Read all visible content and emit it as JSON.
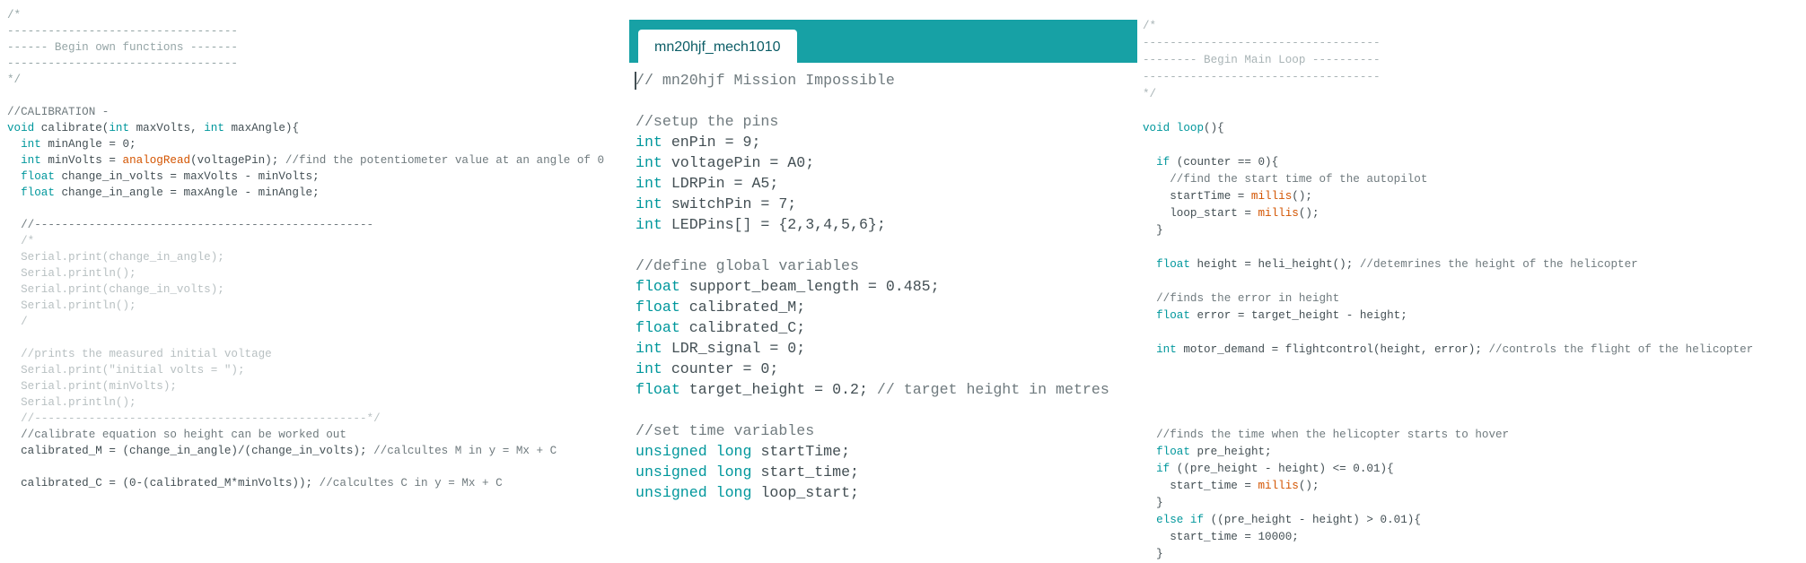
{
  "left_pane": {
    "lines": [
      [
        [
          "/*",
          "ca"
        ]
      ],
      [
        [
          "----------------------------------",
          "ca"
        ]
      ],
      [
        [
          "------ Begin own functions -------",
          "ca"
        ]
      ],
      [
        [
          "----------------------------------",
          "ca"
        ]
      ],
      [
        [
          "*/",
          "ca"
        ]
      ],
      [
        [
          "",
          ""
        ]
      ],
      [
        [
          "//CALIBRATION -",
          "cb"
        ]
      ],
      [
        [
          "void",
          "k"
        ],
        [
          " calibrate(",
          ""
        ],
        [
          "int",
          "k"
        ],
        [
          " maxVolts, ",
          ""
        ],
        [
          "int",
          "k"
        ],
        [
          " maxAngle){",
          ""
        ]
      ],
      [
        [
          "  ",
          ""
        ],
        [
          "int",
          "k"
        ],
        [
          " minAngle = 0;",
          ""
        ]
      ],
      [
        [
          "  ",
          ""
        ],
        [
          "int",
          "k"
        ],
        [
          " minVolts = ",
          ""
        ],
        [
          "analogRead",
          "f"
        ],
        [
          "(voltagePin); ",
          ""
        ],
        [
          "//find the potentiometer value at an angle of 0",
          "cb"
        ]
      ],
      [
        [
          "  ",
          ""
        ],
        [
          "float",
          "k"
        ],
        [
          " change_in_volts = maxVolts - minVolts;",
          ""
        ]
      ],
      [
        [
          "  ",
          ""
        ],
        [
          "float",
          "k"
        ],
        [
          " change_in_angle = maxAngle - minAngle;",
          ""
        ]
      ],
      [
        [
          "",
          ""
        ]
      ],
      [
        [
          "  //--------------------------------------------------",
          "cb"
        ]
      ],
      [
        [
          "  /*",
          "cl"
        ]
      ],
      [
        [
          "  Serial.print(change_in_angle);",
          "cl"
        ]
      ],
      [
        [
          "  Serial.println();",
          "cl"
        ]
      ],
      [
        [
          "  Serial.print(change_in_volts);",
          "cl"
        ]
      ],
      [
        [
          "  Serial.println();",
          "cl"
        ]
      ],
      [
        [
          "  /",
          "cl"
        ]
      ],
      [
        [
          "",
          ""
        ]
      ],
      [
        [
          "  //prints the measured initial voltage",
          "cl"
        ]
      ],
      [
        [
          "  Serial.print(\"initial volts = \");",
          "cl"
        ]
      ],
      [
        [
          "  Serial.print(minVolts);",
          "cl"
        ]
      ],
      [
        [
          "  Serial.println();",
          "cl"
        ]
      ],
      [
        [
          "  //-------------------------------------------------*/",
          "cl"
        ]
      ],
      [
        [
          "  ",
          ""
        ],
        [
          "//calibrate equation so height can be worked out",
          "cb"
        ]
      ],
      [
        [
          "  calibrated_M = (change_in_angle)/(change_in_volts); ",
          ""
        ],
        [
          "//calcultes M in y = Mx + C",
          "cb"
        ]
      ],
      [
        [
          "",
          ""
        ]
      ],
      [
        [
          "  calibrated_C = (0-(calibrated_M*minVolts)); ",
          ""
        ],
        [
          "//calcultes C in y = Mx + C",
          "cb"
        ]
      ]
    ]
  },
  "middle_pane": {
    "tab_label": "mn20hjf_mech1010",
    "lines": [
      [
        [
          "// mn20hjf Mission Impossible",
          "cb"
        ]
      ],
      [
        [
          "",
          ""
        ]
      ],
      [
        [
          "//setup the pins",
          "cb"
        ]
      ],
      [
        [
          "int",
          "k"
        ],
        [
          " enPin = 9;",
          ""
        ]
      ],
      [
        [
          "int",
          "k"
        ],
        [
          " voltagePin = A0;",
          ""
        ]
      ],
      [
        [
          "int",
          "k"
        ],
        [
          " LDRPin = A5;",
          ""
        ]
      ],
      [
        [
          "int",
          "k"
        ],
        [
          " switchPin = 7;",
          ""
        ]
      ],
      [
        [
          "int",
          "k"
        ],
        [
          " LEDPins[] = {2,3,4,5,6};",
          ""
        ]
      ],
      [
        [
          "",
          ""
        ]
      ],
      [
        [
          "//define global variables",
          "cb"
        ]
      ],
      [
        [
          "float",
          "k"
        ],
        [
          " support_beam_length = 0.485;",
          ""
        ]
      ],
      [
        [
          "float",
          "k"
        ],
        [
          " calibrated_M;",
          ""
        ]
      ],
      [
        [
          "float",
          "k"
        ],
        [
          " calibrated_C;",
          ""
        ]
      ],
      [
        [
          "int",
          "k"
        ],
        [
          " LDR_signal = 0;",
          ""
        ]
      ],
      [
        [
          "int",
          "k"
        ],
        [
          " counter = 0;",
          ""
        ]
      ],
      [
        [
          "float",
          "k"
        ],
        [
          " target_height = 0.2; ",
          ""
        ],
        [
          "// target height in metres",
          "cb"
        ]
      ],
      [
        [
          "",
          ""
        ]
      ],
      [
        [
          "//set time variables",
          "cb"
        ]
      ],
      [
        [
          "unsigned",
          "k"
        ],
        [
          " ",
          ""
        ],
        [
          "long",
          "k"
        ],
        [
          " startTime;",
          ""
        ]
      ],
      [
        [
          "unsigned",
          "k"
        ],
        [
          " ",
          ""
        ],
        [
          "long",
          "k"
        ],
        [
          " start_time;",
          ""
        ]
      ],
      [
        [
          "unsigned",
          "k"
        ],
        [
          " ",
          ""
        ],
        [
          "long",
          "k"
        ],
        [
          " loop_start;",
          ""
        ]
      ]
    ]
  },
  "right_pane": {
    "lines": [
      [
        [
          "/*",
          "cp"
        ]
      ],
      [
        [
          "-----------------------------------",
          "cp"
        ]
      ],
      [
        [
          "-------- Begin Main Loop ----------",
          "cp"
        ]
      ],
      [
        [
          "-----------------------------------",
          "cp"
        ]
      ],
      [
        [
          "*/",
          "cp"
        ]
      ],
      [
        [
          "",
          ""
        ]
      ],
      [
        [
          "void",
          "k"
        ],
        [
          " ",
          ""
        ],
        [
          "loop",
          "k"
        ],
        [
          "(){",
          ""
        ]
      ],
      [
        [
          "",
          ""
        ]
      ],
      [
        [
          "  ",
          ""
        ],
        [
          "if",
          "k"
        ],
        [
          " (counter == 0){",
          ""
        ]
      ],
      [
        [
          "    ",
          ""
        ],
        [
          "//find the start time of the autopilot",
          "cb"
        ]
      ],
      [
        [
          "    startTime = ",
          ""
        ],
        [
          "millis",
          "f"
        ],
        [
          "();",
          ""
        ]
      ],
      [
        [
          "    loop_start = ",
          ""
        ],
        [
          "millis",
          "f"
        ],
        [
          "();",
          ""
        ]
      ],
      [
        [
          "  }",
          ""
        ]
      ],
      [
        [
          "",
          ""
        ]
      ],
      [
        [
          "  ",
          ""
        ],
        [
          "float",
          "k"
        ],
        [
          " height = heli_height(); ",
          ""
        ],
        [
          "//detemrines the height of the helicopter",
          "cb"
        ]
      ],
      [
        [
          "",
          ""
        ]
      ],
      [
        [
          "  ",
          ""
        ],
        [
          "//finds the error in height",
          "cb"
        ]
      ],
      [
        [
          "  ",
          ""
        ],
        [
          "float",
          "k"
        ],
        [
          " error = target_height - height;",
          ""
        ]
      ],
      [
        [
          "",
          ""
        ]
      ],
      [
        [
          "  ",
          ""
        ],
        [
          "int",
          "k"
        ],
        [
          " motor_demand = flightcontrol(height, error); ",
          ""
        ],
        [
          "//controls the flight of the helicopter",
          "cb"
        ]
      ],
      [
        [
          "",
          ""
        ]
      ],
      [
        [
          "",
          ""
        ]
      ],
      [
        [
          "",
          ""
        ]
      ],
      [
        [
          "",
          ""
        ]
      ],
      [
        [
          "  ",
          ""
        ],
        [
          "//finds the time when the helicopter starts to hover",
          "cb"
        ]
      ],
      [
        [
          "  ",
          ""
        ],
        [
          "float",
          "k"
        ],
        [
          " pre_height;",
          ""
        ]
      ],
      [
        [
          "  ",
          ""
        ],
        [
          "if",
          "k"
        ],
        [
          " ((pre_height - height) <= 0.01){",
          ""
        ]
      ],
      [
        [
          "    start_time = ",
          ""
        ],
        [
          "millis",
          "f"
        ],
        [
          "();",
          ""
        ]
      ],
      [
        [
          "  }",
          ""
        ]
      ],
      [
        [
          "  ",
          ""
        ],
        [
          "else",
          "k"
        ],
        [
          " ",
          ""
        ],
        [
          "if",
          "k"
        ],
        [
          " ((pre_height - height) > 0.01){",
          ""
        ]
      ],
      [
        [
          "    start_time = 10000;",
          ""
        ]
      ],
      [
        [
          "  }",
          ""
        ]
      ]
    ]
  }
}
